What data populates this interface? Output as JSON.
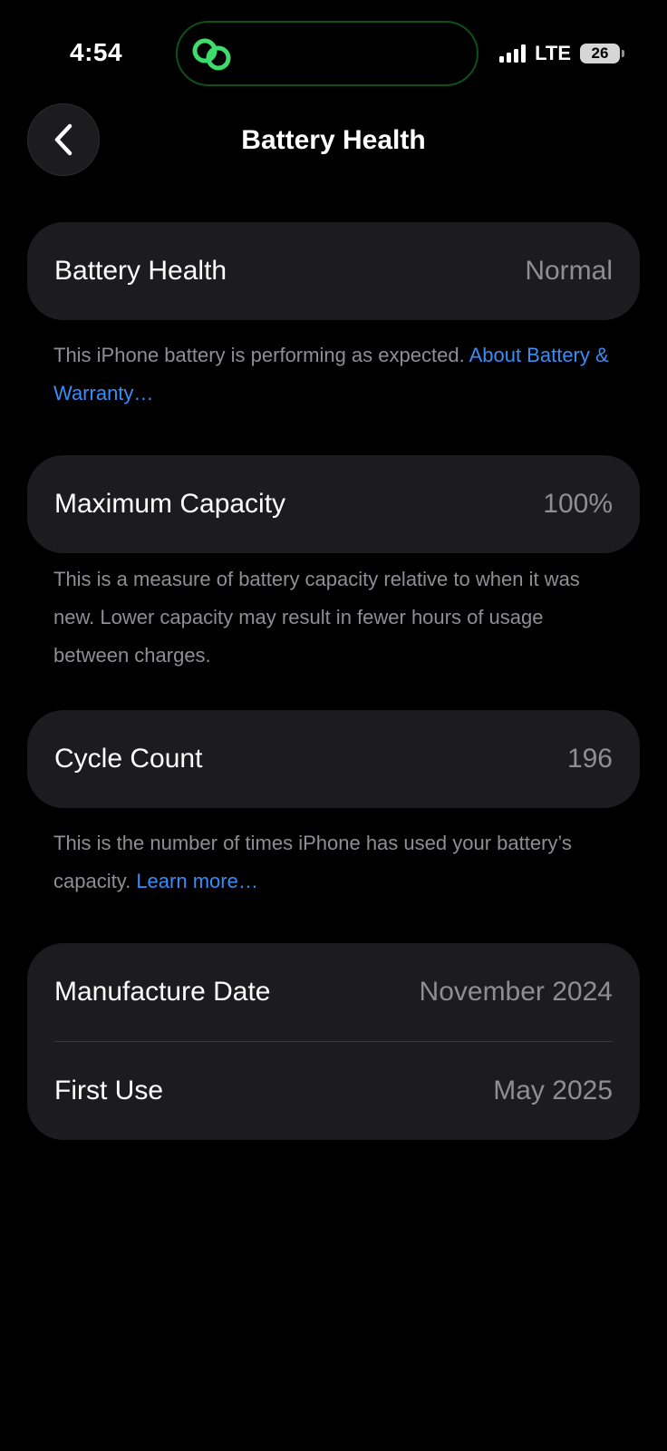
{
  "status_bar": {
    "time": "4:54",
    "network": "LTE",
    "battery_level": "26",
    "island_icon": "link-chain-icon"
  },
  "nav": {
    "title": "Battery Health",
    "back_icon": "chevron-left-icon"
  },
  "battery_health": {
    "label": "Battery Health",
    "value": "Normal",
    "footer_text": "This iPhone battery is performing as expected. ",
    "footer_link": "About Battery & Warranty…"
  },
  "maximum_capacity": {
    "label": "Maximum Capacity",
    "value": "100%",
    "footer_text": "This is a measure of battery capacity relative to when it was new. Lower capacity may result in fewer hours of usage between charges."
  },
  "cycle_count": {
    "label": "Cycle Count",
    "value": "196",
    "footer_text": "This is the number of times iPhone has used your battery’s capacity. ",
    "footer_link": "Learn more…"
  },
  "dates": {
    "manufacture_label": "Manufacture Date",
    "manufacture_value": "November 2024",
    "first_use_label": "First Use",
    "first_use_value": "May 2025"
  },
  "colors": {
    "background": "#000000",
    "card": "#1C1C1E",
    "secondary_text": "#8E8E93",
    "link": "#3A8CF6",
    "island_accent": "#3EDC6A"
  }
}
